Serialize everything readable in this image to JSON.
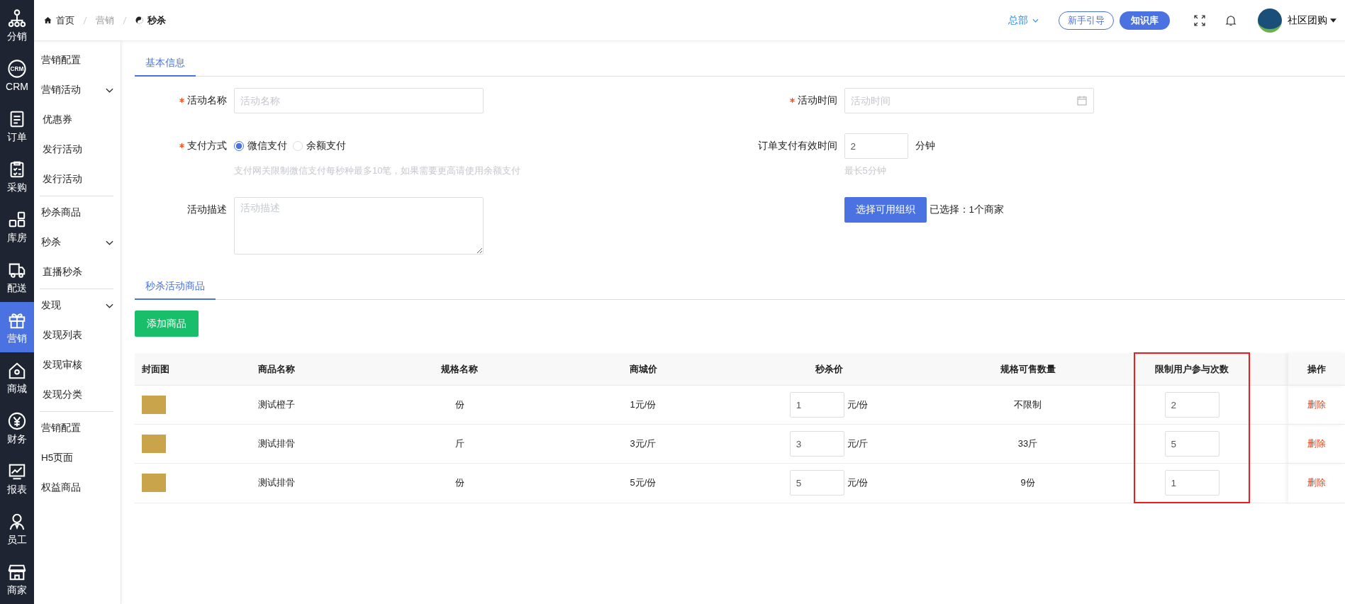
{
  "rail": [
    {
      "label": "分销",
      "kind": "network",
      "selected": false
    },
    {
      "label": "CRM",
      "kind": "crm",
      "icon_text": "CRM",
      "selected": false
    },
    {
      "label": "订单",
      "kind": "order",
      "selected": false
    },
    {
      "label": "采购",
      "kind": "clipboard",
      "selected": false
    },
    {
      "label": "库房",
      "kind": "blocks",
      "selected": false
    },
    {
      "label": "配送",
      "kind": "truck",
      "selected": false
    },
    {
      "label": "营销",
      "kind": "gift",
      "selected": true
    },
    {
      "label": "商城",
      "kind": "house",
      "selected": false
    },
    {
      "label": "财务",
      "kind": "yen",
      "selected": false
    },
    {
      "label": "报表",
      "kind": "chart",
      "selected": false
    },
    {
      "label": "员工",
      "kind": "person",
      "selected": false
    },
    {
      "label": "商家",
      "kind": "store",
      "selected": false
    }
  ],
  "menu": {
    "sections": [
      {
        "items": [
          {
            "label": "营销配置"
          },
          {
            "label": "营销活动",
            "expanded": true,
            "children": [
              {
                "label": "优惠券"
              },
              {
                "label": "发行活动"
              },
              {
                "label": "发行活动"
              }
            ]
          }
        ]
      },
      {
        "items": [
          {
            "label": "秒杀商品"
          },
          {
            "label": "秒杀",
            "expanded": true,
            "children": [
              {
                "label": "直播秒杀"
              }
            ]
          }
        ]
      },
      {
        "items": [
          {
            "label": "发现",
            "expanded": true,
            "children": [
              {
                "label": "发现列表"
              },
              {
                "label": "发现审核"
              },
              {
                "label": "发现分类"
              }
            ]
          }
        ]
      },
      {
        "items": [
          {
            "label": "营销配置"
          },
          {
            "label": "H5页面"
          },
          {
            "label": "权益商品"
          }
        ]
      }
    ]
  },
  "breadcrumb": [
    {
      "label": "首页",
      "kind": "home"
    },
    {
      "label": "营销",
      "kind": "plain"
    },
    {
      "label": "秒杀",
      "kind": "current"
    }
  ],
  "header": {
    "branch": "总部",
    "guide_button": "新手引导",
    "kb_button": "知识库",
    "user": "社区团购"
  },
  "form": {
    "tabs": [
      {
        "label": "基本信息",
        "selected": true
      }
    ],
    "name": {
      "label": "活动名称",
      "required": true,
      "placeholder": "活动名称"
    },
    "time": {
      "label": "活动时间",
      "required": true,
      "placeholder": "活动时间"
    },
    "payment": {
      "label": "支付方式",
      "required": true,
      "options": [
        {
          "label": "微信支付",
          "selected": true
        },
        {
          "label": "余额支付",
          "selected": false
        }
      ],
      "hint": "支付网关限制微信支付每秒种最多10笔，如果需要更高请使用余额支付"
    },
    "validity": {
      "label": "订单支付有效时间",
      "value": "2",
      "unit": "分钟",
      "hint": "最长5分钟"
    },
    "description": {
      "label": "活动描述",
      "placeholder": "活动描述"
    },
    "org": {
      "button": "选择可用组织",
      "selected_text": "已选择：1个商家"
    }
  },
  "goods": {
    "tabs": [
      {
        "label": "秒杀活动商品",
        "selected": true
      }
    ],
    "add_button": "添加商品",
    "columns": [
      {
        "label": "封面图",
        "highlighted": false
      },
      {
        "label": "商品名称",
        "highlighted": false
      },
      {
        "label": "规格名称",
        "highlighted": false
      },
      {
        "label": "商城价",
        "highlighted": false
      },
      {
        "label": "秒杀价",
        "highlighted": false
      },
      {
        "label": "规格可售数量",
        "highlighted": false
      },
      {
        "label": "限制用户参与次数",
        "highlighted": true
      },
      {
        "label": "操作",
        "highlighted": false
      }
    ],
    "rows": [
      {
        "name": "测试橙子",
        "spec": "份",
        "mall_price": "1元/份",
        "seckill_price": "1",
        "price_unit": "元/份",
        "stock": "不限制",
        "limit": "2",
        "action": "删除"
      },
      {
        "name": "测试排骨",
        "spec": "斤",
        "mall_price": "3元/斤",
        "seckill_price": "3",
        "price_unit": "元/斤",
        "stock": "33斤",
        "limit": "5",
        "action": "删除"
      },
      {
        "name": "测试排骨",
        "spec": "份",
        "mall_price": "5元/份",
        "seckill_price": "5",
        "price_unit": "元/份",
        "stock": "9份",
        "limit": "1",
        "action": "删除"
      }
    ]
  }
}
